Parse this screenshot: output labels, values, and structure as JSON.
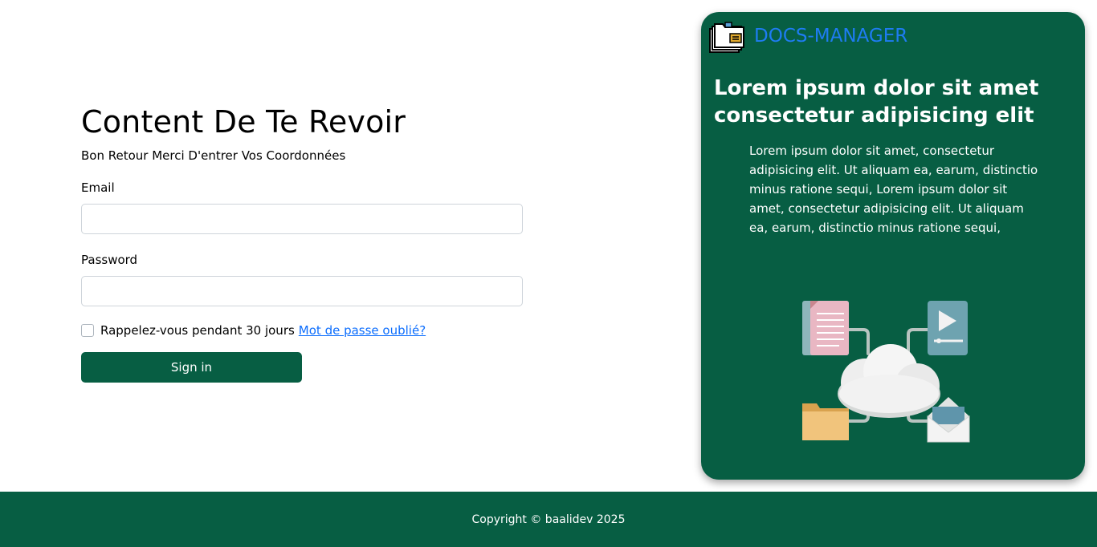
{
  "login": {
    "title": "Content De Te Revoir",
    "subtitle": "Bon Retour Merci D'entrer Vos Coordonnées",
    "email_label": "Email",
    "email_value": "",
    "password_label": "Password",
    "password_value": "",
    "remember_label": "Rappelez-vous pendant 30 jours",
    "remember_checked": false,
    "forgot_link": "Mot de passe oublié?",
    "signin_label": "Sign in"
  },
  "panel": {
    "brand": "DOCS-MANAGER",
    "heading": "Lorem ipsum dolor sit amet consectetur adipisicing elit",
    "description": "Lorem ipsum dolor sit amet, consectetur adipisicing elit. Ut aliquam ea, earum, distinctio minus ratione sequi, Lorem ipsum dolor sit amet, consectetur adipisicing elit. Ut aliquam ea, earum, distinctio minus ratione sequi,"
  },
  "footer": {
    "copyright": "Copyright © baalidev 2025"
  },
  "icons": {
    "brand_logo": "folder-stack-icon",
    "illustration": "cloud-documents-illustration"
  },
  "colors": {
    "primary_green": "#075e43",
    "link_blue": "#0d6efd",
    "brand_blue": "#1e7cf2"
  }
}
